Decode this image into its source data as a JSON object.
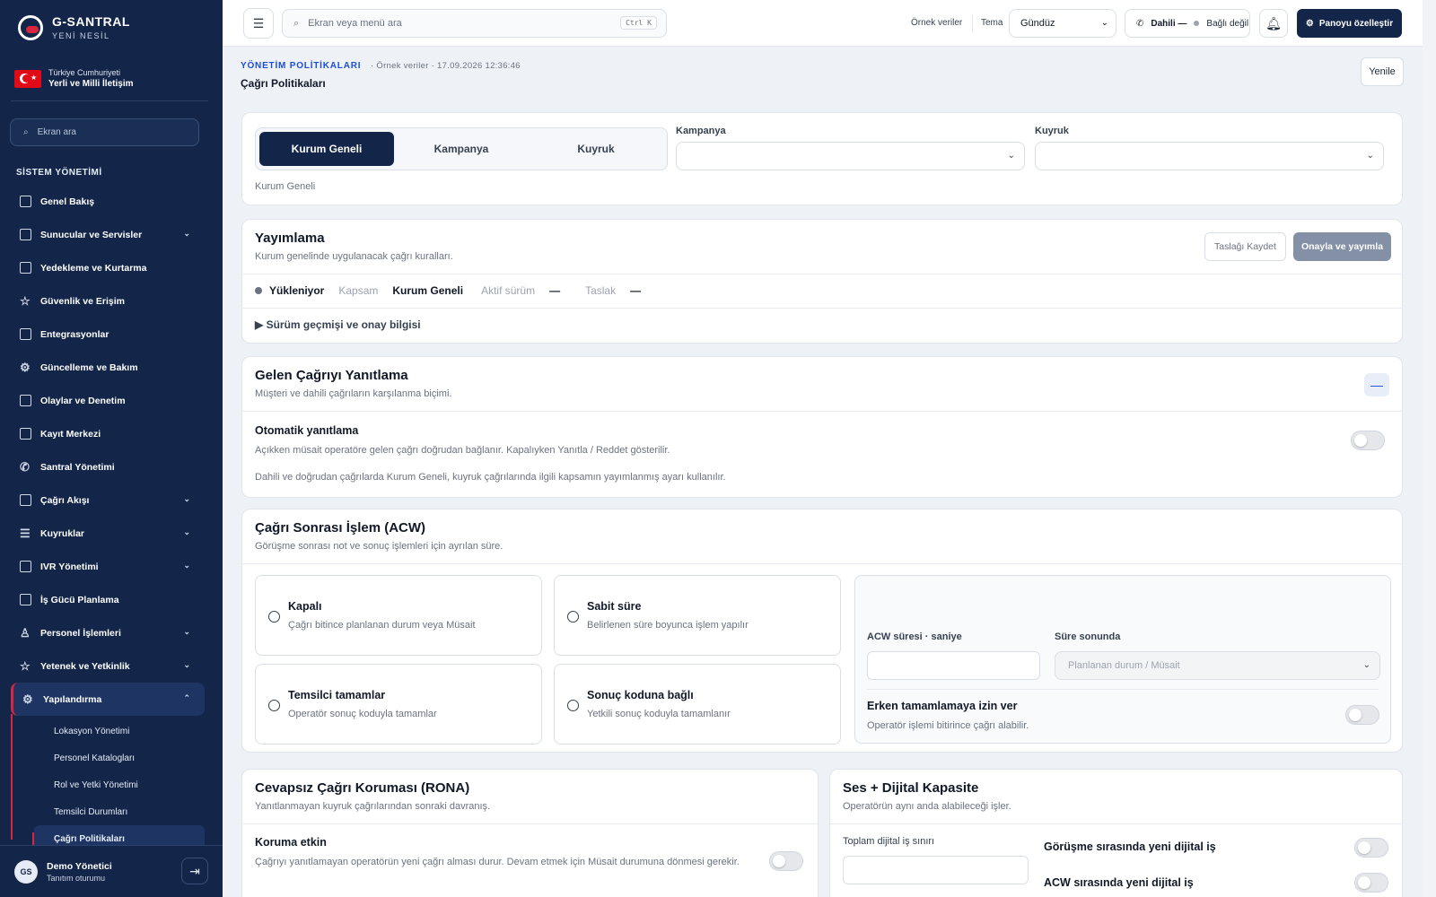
{
  "brand": {
    "name": "G-SANTRAL",
    "sub": "YENİ NESİL",
    "flag_line1": "Türkiye Cumhuriyeti",
    "flag_line2": "Yerli ve Milli İletişim"
  },
  "sidebar": {
    "search_placeholder": "Ekran ara",
    "section": "SİSTEM YÖNETİMİ",
    "items": [
      {
        "label": "Genel Bakış",
        "icon": "dashboard-icon",
        "chev": ""
      },
      {
        "label": "Sunucular ve Servisler",
        "icon": "server-icon",
        "chev": "⌄"
      },
      {
        "label": "Yedekleme ve Kurtarma",
        "icon": "backup-icon",
        "chev": ""
      },
      {
        "label": "Güvenlik ve Erişim",
        "icon": "star-icon",
        "chev": ""
      },
      {
        "label": "Entegrasyonlar",
        "icon": "integration-icon",
        "chev": ""
      },
      {
        "label": "Güncelleme ve Bakım",
        "icon": "gear-icon",
        "chev": ""
      },
      {
        "label": "Olaylar ve Denetim",
        "icon": "audit-icon",
        "chev": ""
      },
      {
        "label": "Kayıt Merkezi",
        "icon": "record-icon",
        "chev": ""
      },
      {
        "label": "Santral Yönetimi",
        "icon": "phone-icon",
        "chev": ""
      },
      {
        "label": "Çağrı Akışı",
        "icon": "flow-icon",
        "chev": "⌄"
      },
      {
        "label": "Kuyruklar",
        "icon": "queue-icon",
        "chev": "⌄"
      },
      {
        "label": "IVR Yönetimi",
        "icon": "ivr-icon",
        "chev": "⌄"
      },
      {
        "label": "İş Gücü Planlama",
        "icon": "calendar-icon",
        "chev": ""
      },
      {
        "label": "Personel İşlemleri",
        "icon": "user-icon",
        "chev": "⌄"
      },
      {
        "label": "Yetenek ve Yetkinlik",
        "icon": "star-icon",
        "chev": "⌄"
      },
      {
        "label": "Yapılandırma",
        "icon": "gear-icon",
        "chev": "⌃"
      }
    ],
    "subitems": [
      "Lokasyon Yönetimi",
      "Personel Katalogları",
      "Rol ve Yetki Yönetimi",
      "Temsilci Durumları",
      "Çağrı Politikaları"
    ],
    "user": {
      "initials": "GS",
      "name": "Demo Yönetici",
      "session": "Tanıtım oturumu"
    }
  },
  "topbar": {
    "search_placeholder": "Ekran veya menü ara",
    "shortcut": "Ctrl K",
    "demo": "Örnek veriler",
    "theme_label": "Tema",
    "theme_value": "Gündüz",
    "ext_label": "Dahili —",
    "ext_status": "Bağlı değil",
    "customize": "Panoyu özelleştir"
  },
  "page": {
    "eyebrow": "YÖNETİM POLİTİKALARI",
    "meta": "· Örnek veriler · 17.09.2026 12:36:46",
    "title": "Çağrı Politikaları",
    "refresh": "Yenile"
  },
  "scope": {
    "tabs": [
      "Kurum Geneli",
      "Kampanya",
      "Kuyruk"
    ],
    "campaign_label": "Kampanya",
    "queue_label": "Kuyruk",
    "current": "Kurum Geneli"
  },
  "publish": {
    "title": "Yayımlama",
    "desc": "Kurum genelinde uygulanacak çağrı kuralları.",
    "save_draft": "Taslağı Kaydet",
    "approve": "Onayla ve yayımla",
    "status": "Yükleniyor",
    "scope_label": "Kapsam",
    "scope_value": "Kurum Geneli",
    "active_label": "Aktif sürüm",
    "active_value": "—",
    "draft_label": "Taslak",
    "draft_value": "—",
    "history": "▶ Sürüm geçmişi ve onay bilgisi"
  },
  "incoming": {
    "title": "Gelen Çağrıyı Yanıtlama",
    "desc": "Müşteri ve dahili çağrıların karşılanma biçimi.",
    "collapse": "—",
    "auto_title": "Otomatik yanıtlama",
    "auto_desc": "Açıkken müsait operatöre gelen çağrı doğrudan bağlanır. Kapalıyken Yanıtla / Reddet gösterilir.",
    "note": "Dahili ve doğrudan çağrılarda Kurum Geneli, kuyruk çağrılarında ilgili kapsamın yayımlanmış ayarı kullanılır."
  },
  "acw": {
    "title": "Çağrı Sonrası İşlem (ACW)",
    "desc": "Görüşme sonrası not ve sonuç işlemleri için ayrılan süre.",
    "options": [
      {
        "title": "Kapalı",
        "desc": "Çağrı bitince planlanan durum veya Müsait"
      },
      {
        "title": "Sabit süre",
        "desc": "Belirlenen süre boyunca işlem yapılır"
      },
      {
        "title": "Temsilci tamamlar",
        "desc": "Operatör sonuç koduyla tamamlar"
      },
      {
        "title": "Sonuç koduna bağlı",
        "desc": "Yetkili sonuç koduyla tamamlanır"
      }
    ],
    "duration_label": "ACW süresi · saniye",
    "after_label": "Süre sonunda",
    "after_placeholder": "Planlanan durum / Müsait",
    "early_title": "Erken tamamlamaya izin ver",
    "early_desc": "Operatör işlemi bitirince çağrı alabilir."
  },
  "rona": {
    "title": "Cevapsız Çağrı Koruması (RONA)",
    "desc": "Yanıtlanmayan kuyruk çağrılarından sonraki davranış.",
    "protect_title": "Koruma etkin",
    "protect_desc": "Çağrıyı yanıtlamayan operatörün yeni çağrı alması durur. Devam etmek için Müsait durumuna dönmesi gerekir."
  },
  "capacity": {
    "title": "Ses + Dijital Kapasite",
    "desc": "Operatörün aynı anda alabileceği işler.",
    "limit_label": "Toplam dijital iş sınırı",
    "during_call": "Görüşme sırasında yeni dijital iş",
    "during_acw": "ACW sırasında yeni dijital iş"
  }
}
